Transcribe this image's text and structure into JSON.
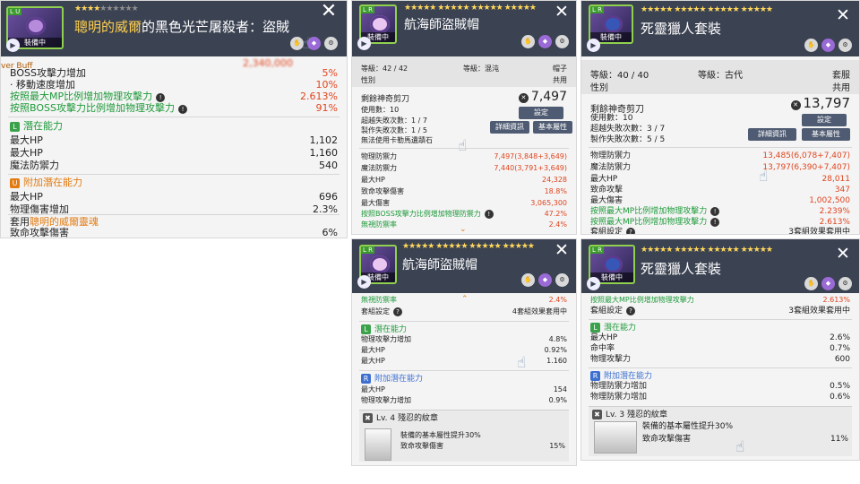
{
  "colors": {
    "header": "#3b4252",
    "green": "#1e9a3a",
    "red": "#e0451f",
    "orange": "#e27b12",
    "star": "#ffd75a"
  },
  "p1": {
    "thumb_lv": "L U",
    "equipped": "裝備中",
    "title_hl": "聰明的威爾",
    "title_rest": "的黑色光芒屠殺者：盜賊",
    "cut_top": "2,340,000",
    "rows": [
      {
        "l": "BOSS攻擊力增加",
        "v": "5%"
      },
      {
        "l": "· 移動速度增加",
        "v": "10%"
      },
      {
        "l": "按照最大MP比例增加物理攻擊力",
        "v": "2.613%"
      },
      {
        "l": "按照BOSS攻擊力比例增加物理攻擊力",
        "v": "91%"
      }
    ],
    "sec1": "潛在能力",
    "pot": [
      {
        "l": "最大HP",
        "v": "1,102"
      },
      {
        "l": "最大HP",
        "v": "1,160"
      },
      {
        "l": "魔法防禦力",
        "v": "540"
      }
    ],
    "sec2": "附加潛在能力",
    "add": [
      {
        "l": "最大HP",
        "v": "696"
      },
      {
        "l": "物理傷害增加",
        "v": "2.3%"
      }
    ],
    "set_prefix": "套用",
    "set_name": "聰明的威爾靈魂",
    "set_row": {
      "l": "致命攻擊傷害",
      "v": "6%"
    },
    "side_tag": "ver Buff"
  },
  "p2": {
    "thumb_lv": "L R",
    "equipped": "裝備中",
    "title": "航海師盜賊帽",
    "level": "等級：42 / 42",
    "grade": "等級：混沌",
    "slot": "帽子",
    "gender_l": "性別",
    "gender_v": "共用",
    "gem_l": "剩餘神奇剪刀",
    "gem_v": "7,497",
    "use": "使用數：10",
    "over": "超越失敗次數：1 / 7",
    "craft": "製作失敗次數：1 / 5",
    "note": "無法使用卡勒馬遺蹟石",
    "b_set": "設定",
    "b_info": "詳細資訊",
    "b_base": "基本屬性",
    "stats": [
      {
        "l": "物理防禦力",
        "v": "7,497(3,848+3,649)",
        "c": "red"
      },
      {
        "l": "魔法防禦力",
        "v": "7,440(3,791+3,649)",
        "c": "red"
      },
      {
        "l": "最大HP",
        "v": "24,328",
        "c": "red"
      },
      {
        "l": "致命攻擊傷害",
        "v": "18.8%",
        "c": "red"
      },
      {
        "l": "最大傷害",
        "v": "3,065,300",
        "c": "red"
      },
      {
        "l": "按照BOSS攻擊力比例增加物理防禦力",
        "v": "47.2%",
        "c": "red"
      },
      {
        "l": "無視防禦率",
        "v": "2.4%",
        "c": "red"
      }
    ]
  },
  "p3": {
    "thumb_lv": "L R",
    "equipped": "裝備中",
    "title": "死靈獵人套裝",
    "level": "等級：40 / 40",
    "grade": "等級：古代",
    "slot": "套服",
    "gender_l": "性別",
    "gender_v": "共用",
    "gem_l": "剩餘神奇剪刀",
    "gem_v": "13,797",
    "use": "使用數：10",
    "over": "超越失敗次數：3 / 7",
    "craft": "製作失敗次數：5 / 5",
    "b_set": "設定",
    "b_info": "詳細資訊",
    "b_base": "基本屬性",
    "stats": [
      {
        "l": "物理防禦力",
        "v": "13,485(6,078+7,407)",
        "c": "red"
      },
      {
        "l": "魔法防禦力",
        "v": "13,797(6,390+7,407)",
        "c": "red"
      },
      {
        "l": "最大HP",
        "v": "28,011",
        "c": "red"
      },
      {
        "l": "致命攻擊",
        "v": "347",
        "c": "red"
      },
      {
        "l": "最大傷害",
        "v": "1,002,500",
        "c": "red"
      },
      {
        "l": "按照最大MP比例增加物理攻擊力",
        "v": "2.239%",
        "c": "red"
      },
      {
        "l": "按照最大MP比例增加物理攻擊力",
        "v": "2.613%",
        "c": "red"
      }
    ],
    "set_l": "套組設定",
    "set_v": "3套組效果套用中"
  },
  "p4": {
    "thumb_lv": "L R",
    "equipped": "裝備中",
    "title": "航海師盜賊帽",
    "cut": {
      "l": "無視防禦率",
      "v": "2.4%"
    },
    "set_l": "套組設定",
    "set_v": "4套組效果套用中",
    "sec1": "潛在能力",
    "pot": [
      {
        "l": "物理攻擊力增加",
        "v": "4.8%"
      },
      {
        "l": "最大HP",
        "v": "0.92%"
      },
      {
        "l": "最大HP",
        "v": "1.160"
      }
    ],
    "sec2": "附加潛在能力",
    "add": [
      {
        "l": "最大HP",
        "v": "154"
      },
      {
        "l": "物理攻擊力增加",
        "v": "0.9%"
      }
    ],
    "emb_title": "Lv. 4 殘忍的紋章",
    "emb_desc": "裝備的基本屬性提升30%",
    "emb_row": {
      "l": "致命攻擊傷害",
      "v": "15%"
    }
  },
  "p5": {
    "thumb_lv": "L R",
    "equipped": "裝備中",
    "title": "死靈獵人套裝",
    "cut": {
      "l": "按照最大MP比例增加物理攻擊力",
      "v": "2.613%"
    },
    "set_l": "套組設定",
    "set_v": "3套組效果套用中",
    "sec1": "潛在能力",
    "pot": [
      {
        "l": "最大HP",
        "v": "2.6%"
      },
      {
        "l": "命中率",
        "v": "0.7%"
      },
      {
        "l": "物理攻擊力",
        "v": "600"
      }
    ],
    "sec2": "附加潛在能力",
    "add": [
      {
        "l": "物理防禦力增加",
        "v": "0.5%"
      },
      {
        "l": "物理防禦力增加",
        "v": "0.6%"
      }
    ],
    "emb_title": "Lv. 3 殘忍的紋章",
    "emb_desc": "裝備的基本屬性提升30%",
    "emb_row": {
      "l": "致命攻擊傷害",
      "v": "11%"
    }
  },
  "icon_names": [
    "close-icon",
    "play-icon",
    "lock-icon",
    "gem-icon",
    "info-icon",
    "hand-cursor-icon",
    "up-chevron-icon",
    "down-chevron-icon"
  ]
}
